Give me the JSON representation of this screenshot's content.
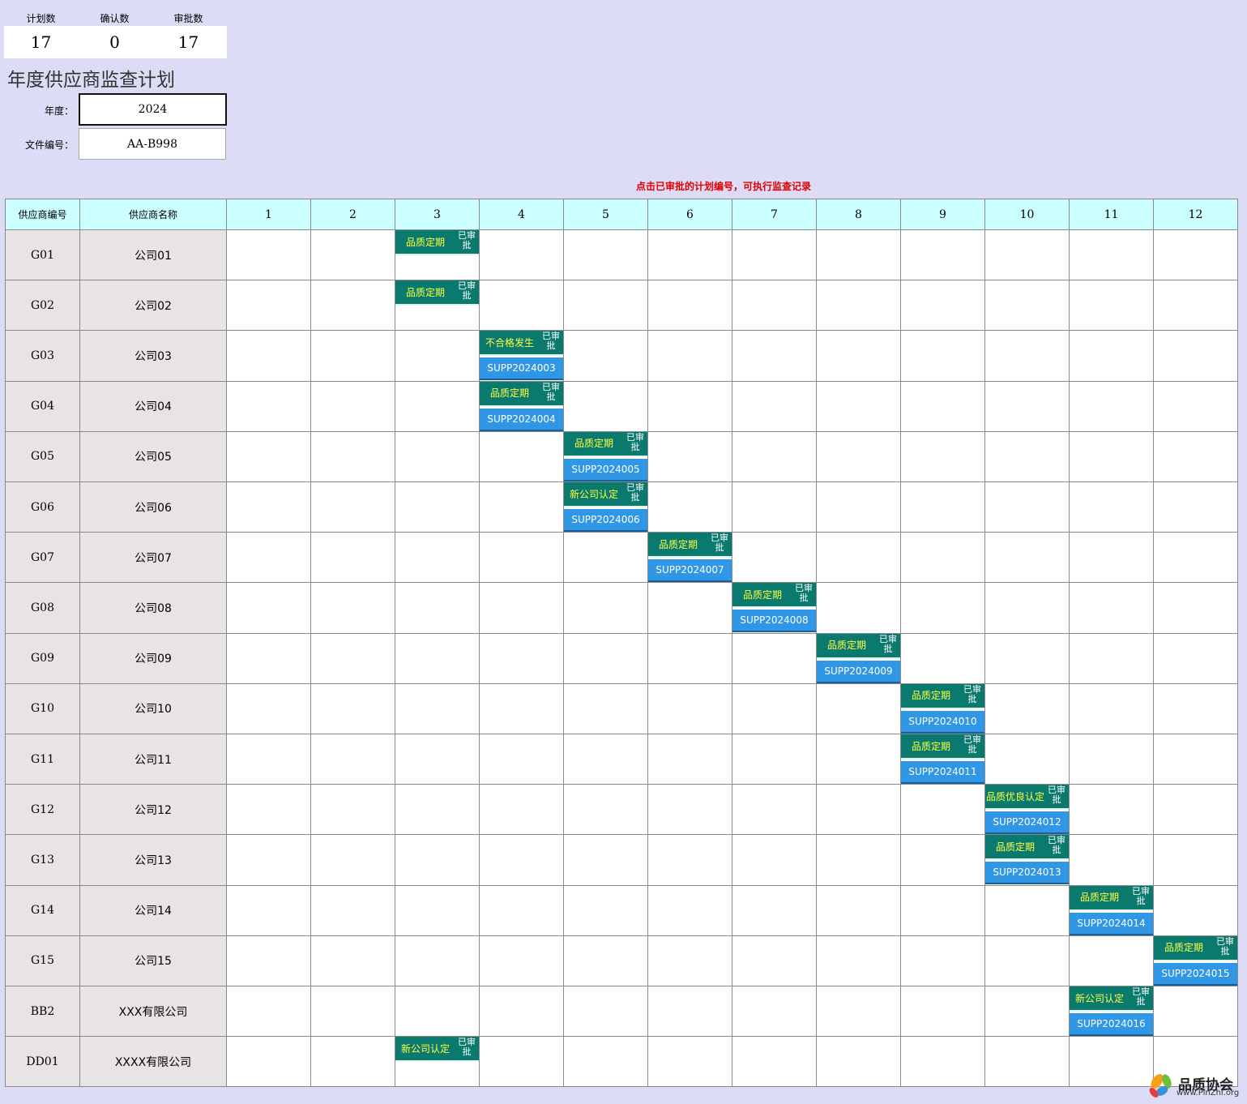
{
  "stats": {
    "labels": [
      "计划数",
      "确认数",
      "审批数"
    ],
    "values": [
      "17",
      "0",
      "17"
    ]
  },
  "title": "年度供应商监查计划",
  "year_label": "年度：",
  "year_value": "2024",
  "docno_label": "文件编号：",
  "docno_value": "AA-B998",
  "hint": "点击已审批的计划编号，可执行监查记录",
  "table": {
    "col_id": "供应商编号",
    "col_name": "供应商名称",
    "months": [
      "1",
      "2",
      "3",
      "4",
      "5",
      "6",
      "7",
      "8",
      "9",
      "10",
      "11",
      "12"
    ],
    "rows": [
      {
        "id": "G01",
        "name": "公司01",
        "plan": {
          "month": 3,
          "type": "品质定期",
          "status": "已审批",
          "no": ""
        }
      },
      {
        "id": "G02",
        "name": "公司02",
        "plan": {
          "month": 3,
          "type": "品质定期",
          "status": "已审批",
          "no": ""
        }
      },
      {
        "id": "G03",
        "name": "公司03",
        "plan": {
          "month": 4,
          "type": "不合格发生",
          "status": "已审批",
          "no": "SUPP2024003"
        }
      },
      {
        "id": "G04",
        "name": "公司04",
        "plan": {
          "month": 4,
          "type": "品质定期",
          "status": "已审批",
          "no": "SUPP2024004"
        }
      },
      {
        "id": "G05",
        "name": "公司05",
        "plan": {
          "month": 5,
          "type": "品质定期",
          "status": "已审批",
          "no": "SUPP2024005"
        }
      },
      {
        "id": "G06",
        "name": "公司06",
        "plan": {
          "month": 5,
          "type": "新公司认定",
          "status": "已审批",
          "no": "SUPP2024006"
        }
      },
      {
        "id": "G07",
        "name": "公司07",
        "plan": {
          "month": 6,
          "type": "品质定期",
          "status": "已审批",
          "no": "SUPP2024007"
        }
      },
      {
        "id": "G08",
        "name": "公司08",
        "plan": {
          "month": 7,
          "type": "品质定期",
          "status": "已审批",
          "no": "SUPP2024008"
        }
      },
      {
        "id": "G09",
        "name": "公司09",
        "plan": {
          "month": 8,
          "type": "品质定期",
          "status": "已审批",
          "no": "SUPP2024009"
        }
      },
      {
        "id": "G10",
        "name": "公司10",
        "plan": {
          "month": 9,
          "type": "品质定期",
          "status": "已审批",
          "no": "SUPP2024010"
        }
      },
      {
        "id": "G11",
        "name": "公司11",
        "plan": {
          "month": 9,
          "type": "品质定期",
          "status": "已审批",
          "no": "SUPP2024011"
        }
      },
      {
        "id": "G12",
        "name": "公司12",
        "plan": {
          "month": 10,
          "type": "品质优良认定",
          "status": "已审批",
          "no": "SUPP2024012"
        }
      },
      {
        "id": "G13",
        "name": "公司13",
        "plan": {
          "month": 10,
          "type": "品质定期",
          "status": "已审批",
          "no": "SUPP2024013"
        }
      },
      {
        "id": "G14",
        "name": "公司14",
        "plan": {
          "month": 11,
          "type": "品质定期",
          "status": "已审批",
          "no": "SUPP2024014"
        }
      },
      {
        "id": "G15",
        "name": "公司15",
        "plan": {
          "month": 12,
          "type": "品质定期",
          "status": "已审批",
          "no": "SUPP2024015"
        }
      },
      {
        "id": "BB2",
        "name": "XXX有限公司",
        "plan": {
          "month": 11,
          "type": "新公司认定",
          "status": "已审批",
          "no": "SUPP2024016"
        }
      },
      {
        "id": "DD01",
        "name": "XXXX有限公司",
        "plan": {
          "month": 3,
          "type": "新公司认定",
          "status": "已审批",
          "no": ""
        }
      }
    ]
  },
  "logo": {
    "text": "品质协会",
    "url": "www.PinZhi.org"
  },
  "colors": {
    "plan_header": "#0b7a6e",
    "plan_type_text": "#ffff40",
    "plan_no": "#2f97e6",
    "hint": "#e00000",
    "header_bg": "#ccffff",
    "page_bg": "#dcdcf6"
  }
}
